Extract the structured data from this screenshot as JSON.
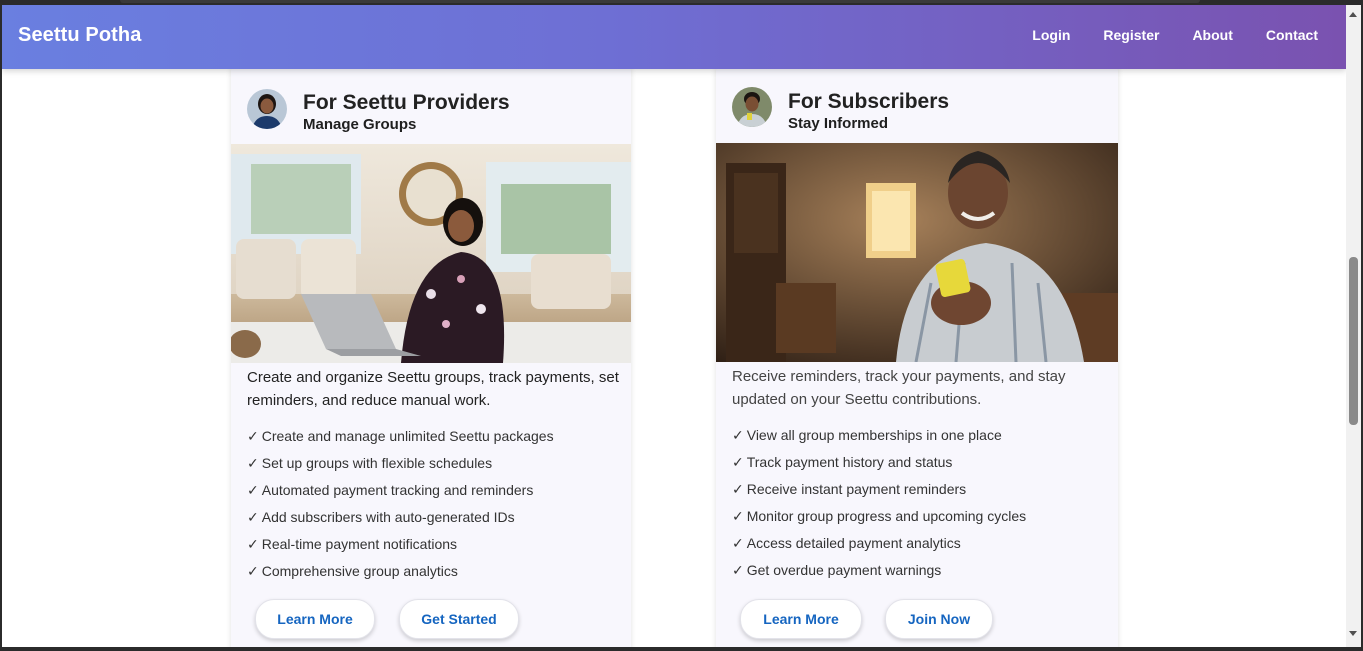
{
  "navbar": {
    "brand": "Seettu Potha",
    "links": [
      "Login",
      "Register",
      "About",
      "Contact"
    ],
    "gradient_start": "#6a7fe0",
    "gradient_end": "#7a52b0"
  },
  "providers_card": {
    "title": "For Seettu Providers",
    "subtitle": "Manage Groups",
    "description": "Create and organize Seettu groups, track payments, set reminders, and reduce manual work.",
    "features": [
      "Create and manage unlimited Seettu packages",
      "Set up groups with flexible schedules",
      "Automated payment tracking and reminders",
      "Add subscribers with auto-generated IDs",
      "Real-time payment notifications",
      "Comprehensive group analytics"
    ],
    "check_mark": "✓",
    "buttons": {
      "learn_more": "Learn More",
      "primary": "Get Started"
    }
  },
  "subscribers_card": {
    "title": "For Subscribers",
    "subtitle": "Stay Informed",
    "description": "Receive reminders, track your payments, and stay updated on your Seettu contributions.",
    "features": [
      "View all group memberships in one place",
      "Track payment history and status",
      "Receive instant payment reminders",
      "Monitor group progress and upcoming cycles",
      "Access detailed payment analytics",
      "Get overdue payment warnings"
    ],
    "check_mark": "✓",
    "buttons": {
      "learn_more": "Learn More",
      "primary": "Join Now"
    }
  },
  "colors": {
    "button_text": "#1565c0",
    "card_bg": "#f8f7fd"
  }
}
